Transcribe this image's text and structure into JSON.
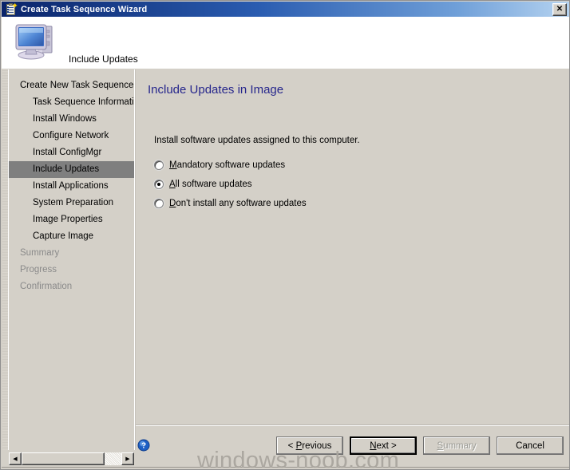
{
  "window": {
    "title": "Create Task Sequence Wizard",
    "title_icon": "task-sequence-icon",
    "close_label": "✕"
  },
  "banner": {
    "icon": "computer-icon",
    "heading": "Include Updates"
  },
  "sidebar": {
    "items": [
      {
        "label": "Create New Task Sequence",
        "level": "root",
        "state": "normal"
      },
      {
        "label": "Task Sequence Information",
        "level": "child",
        "state": "normal"
      },
      {
        "label": "Install Windows",
        "level": "child",
        "state": "normal"
      },
      {
        "label": "Configure Network",
        "level": "child",
        "state": "normal"
      },
      {
        "label": "Install ConfigMgr",
        "level": "child",
        "state": "normal"
      },
      {
        "label": "Include Updates",
        "level": "child",
        "state": "selected"
      },
      {
        "label": "Install Applications",
        "level": "child",
        "state": "normal"
      },
      {
        "label": "System Preparation",
        "level": "child",
        "state": "normal"
      },
      {
        "label": "Image Properties",
        "level": "child",
        "state": "normal"
      },
      {
        "label": "Capture Image",
        "level": "child",
        "state": "normal"
      },
      {
        "label": "Summary",
        "level": "tail",
        "state": "dimmed"
      },
      {
        "label": "Progress",
        "level": "tail",
        "state": "dimmed"
      },
      {
        "label": "Confirmation",
        "level": "tail",
        "state": "dimmed"
      }
    ]
  },
  "content": {
    "page_title": "Include Updates in Image",
    "instruction": "Install software updates assigned to this computer.",
    "radio_options": [
      {
        "label": "Mandatory software updates",
        "accel": "M",
        "rest": "andatory software updates",
        "checked": false
      },
      {
        "label": "All software updates",
        "accel": "A",
        "rest": "ll software updates",
        "checked": true
      },
      {
        "label": "Don't install any software updates",
        "accel": "D",
        "rest": "on't install any software updates",
        "checked": false
      }
    ]
  },
  "footer": {
    "help_icon": "help-icon",
    "buttons": [
      {
        "label": "< Previous",
        "pre": "< ",
        "accel": "P",
        "post": "revious",
        "style": "plain",
        "disabled": false
      },
      {
        "label": "Next >",
        "pre": "",
        "accel": "N",
        "post": "ext >",
        "style": "default",
        "disabled": false
      },
      {
        "label": "Summary",
        "pre": "",
        "accel": "S",
        "post": "ummary",
        "style": "plain",
        "disabled": true
      },
      {
        "label": "Cancel",
        "pre": "",
        "accel": "",
        "post": "Cancel",
        "style": "plain",
        "disabled": false
      }
    ]
  },
  "scrollbar": {
    "left_arrow": "◀",
    "right_arrow": "▶"
  },
  "watermark": {
    "text": "windows-noob.com"
  },
  "colors": {
    "titlebar_start": "#0a246a",
    "titlebar_end": "#b5d3f0",
    "face": "#d4d0c8",
    "selection": "#7f7f7f",
    "page_title": "#26268c",
    "disabled_text": "#8a8a8a"
  }
}
